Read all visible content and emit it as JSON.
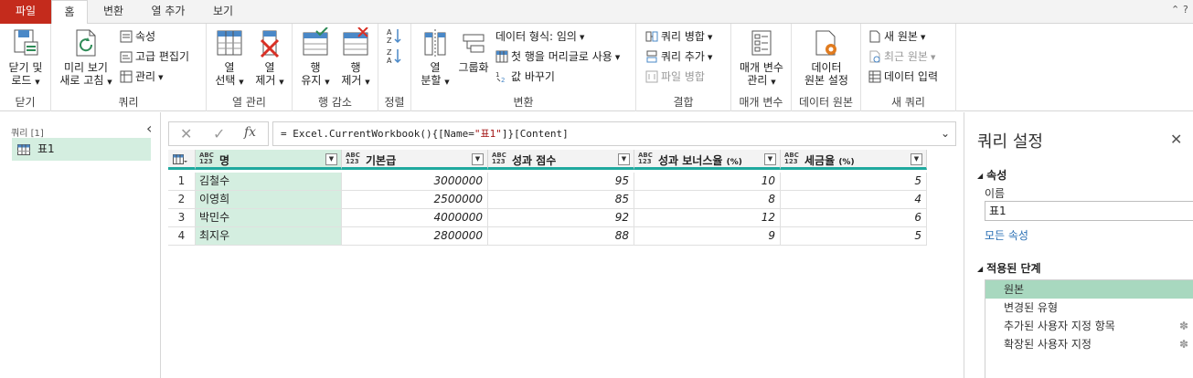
{
  "tabs": [
    "파일",
    "홈",
    "변환",
    "열 추가",
    "보기"
  ],
  "ribbon": {
    "close_apply": {
      "line1": "닫기 및",
      "line2": "로드",
      "group": "닫기"
    },
    "refresh_preview": {
      "line1": "미리 보기",
      "line2": "새로 고침"
    },
    "properties": "속성",
    "advanced_editor": "고급 편집기",
    "manage": "관리",
    "query_group": "쿼리",
    "choose_columns": {
      "line1": "열",
      "line2": "선택"
    },
    "remove_columns": {
      "line1": "열",
      "line2": "제거"
    },
    "manage_columns_group": "열 관리",
    "keep_rows": {
      "line1": "행",
      "line2": "유지"
    },
    "remove_rows": {
      "line1": "행",
      "line2": "제거"
    },
    "reduce_rows_group": "행 감소",
    "sort_group": "정렬",
    "split_column": {
      "line1": "열",
      "line2": "분할"
    },
    "group_by": "그룹화",
    "data_type": "데이터 형식: 임의",
    "first_row_header": "첫 행을 머리글로 사용",
    "replace_values": "값 바꾸기",
    "transform_group": "변환",
    "merge_queries": "쿼리 병합",
    "append_queries": "쿼리 추가",
    "combine_files": "파일 병합",
    "combine_group": "결합",
    "manage_params": {
      "line1": "매개 변수",
      "line2": "관리"
    },
    "params_group": "매개 변수",
    "data_source_settings": {
      "line1": "데이터",
      "line2": "원본 설정"
    },
    "data_sources_group": "데이터 원본",
    "new_source": "새 원본",
    "recent_sources": "최근 원본",
    "enter_data": "데이터 입력",
    "new_query_group": "새 쿼리"
  },
  "left_pane": {
    "title": "쿼리 [1]",
    "items": [
      "표1"
    ]
  },
  "formula": {
    "prefix": "= Excel.CurrentWorkbook(){[Name=",
    "string": "\"표1\"",
    "suffix": "]}[Content]"
  },
  "table": {
    "type_icon": {
      "top": "ABC",
      "bottom": "123"
    },
    "columns": [
      {
        "name": "명",
        "unit": ""
      },
      {
        "name": "기본급",
        "unit": ""
      },
      {
        "name": "성과 점수",
        "unit": ""
      },
      {
        "name": "성과 보너스율",
        "unit": "(%)"
      },
      {
        "name": "세금율",
        "unit": "(%)"
      }
    ],
    "rows": [
      [
        "1",
        "김철수",
        "3000000",
        "95",
        "10",
        "5"
      ],
      [
        "2",
        "이영희",
        "2500000",
        "85",
        "8",
        "4"
      ],
      [
        "3",
        "박민수",
        "4000000",
        "92",
        "12",
        "6"
      ],
      [
        "4",
        "최지우",
        "2800000",
        "88",
        "9",
        "5"
      ]
    ]
  },
  "right_pane": {
    "title": "쿼리 설정",
    "properties_header": "속성",
    "name_label": "이름",
    "name_value": "표1",
    "all_properties_link": "모든 속성",
    "steps_header": "적용된 단계",
    "steps": [
      "원본",
      "변경된 유형",
      "추가된 사용자 지정 항목",
      "확장된 사용자 지정"
    ]
  },
  "colors": {
    "accent": "#1fa99e",
    "file_tab": "#c42b1c",
    "selected": "#d4eee0",
    "step_selected": "#a8d8bf"
  }
}
